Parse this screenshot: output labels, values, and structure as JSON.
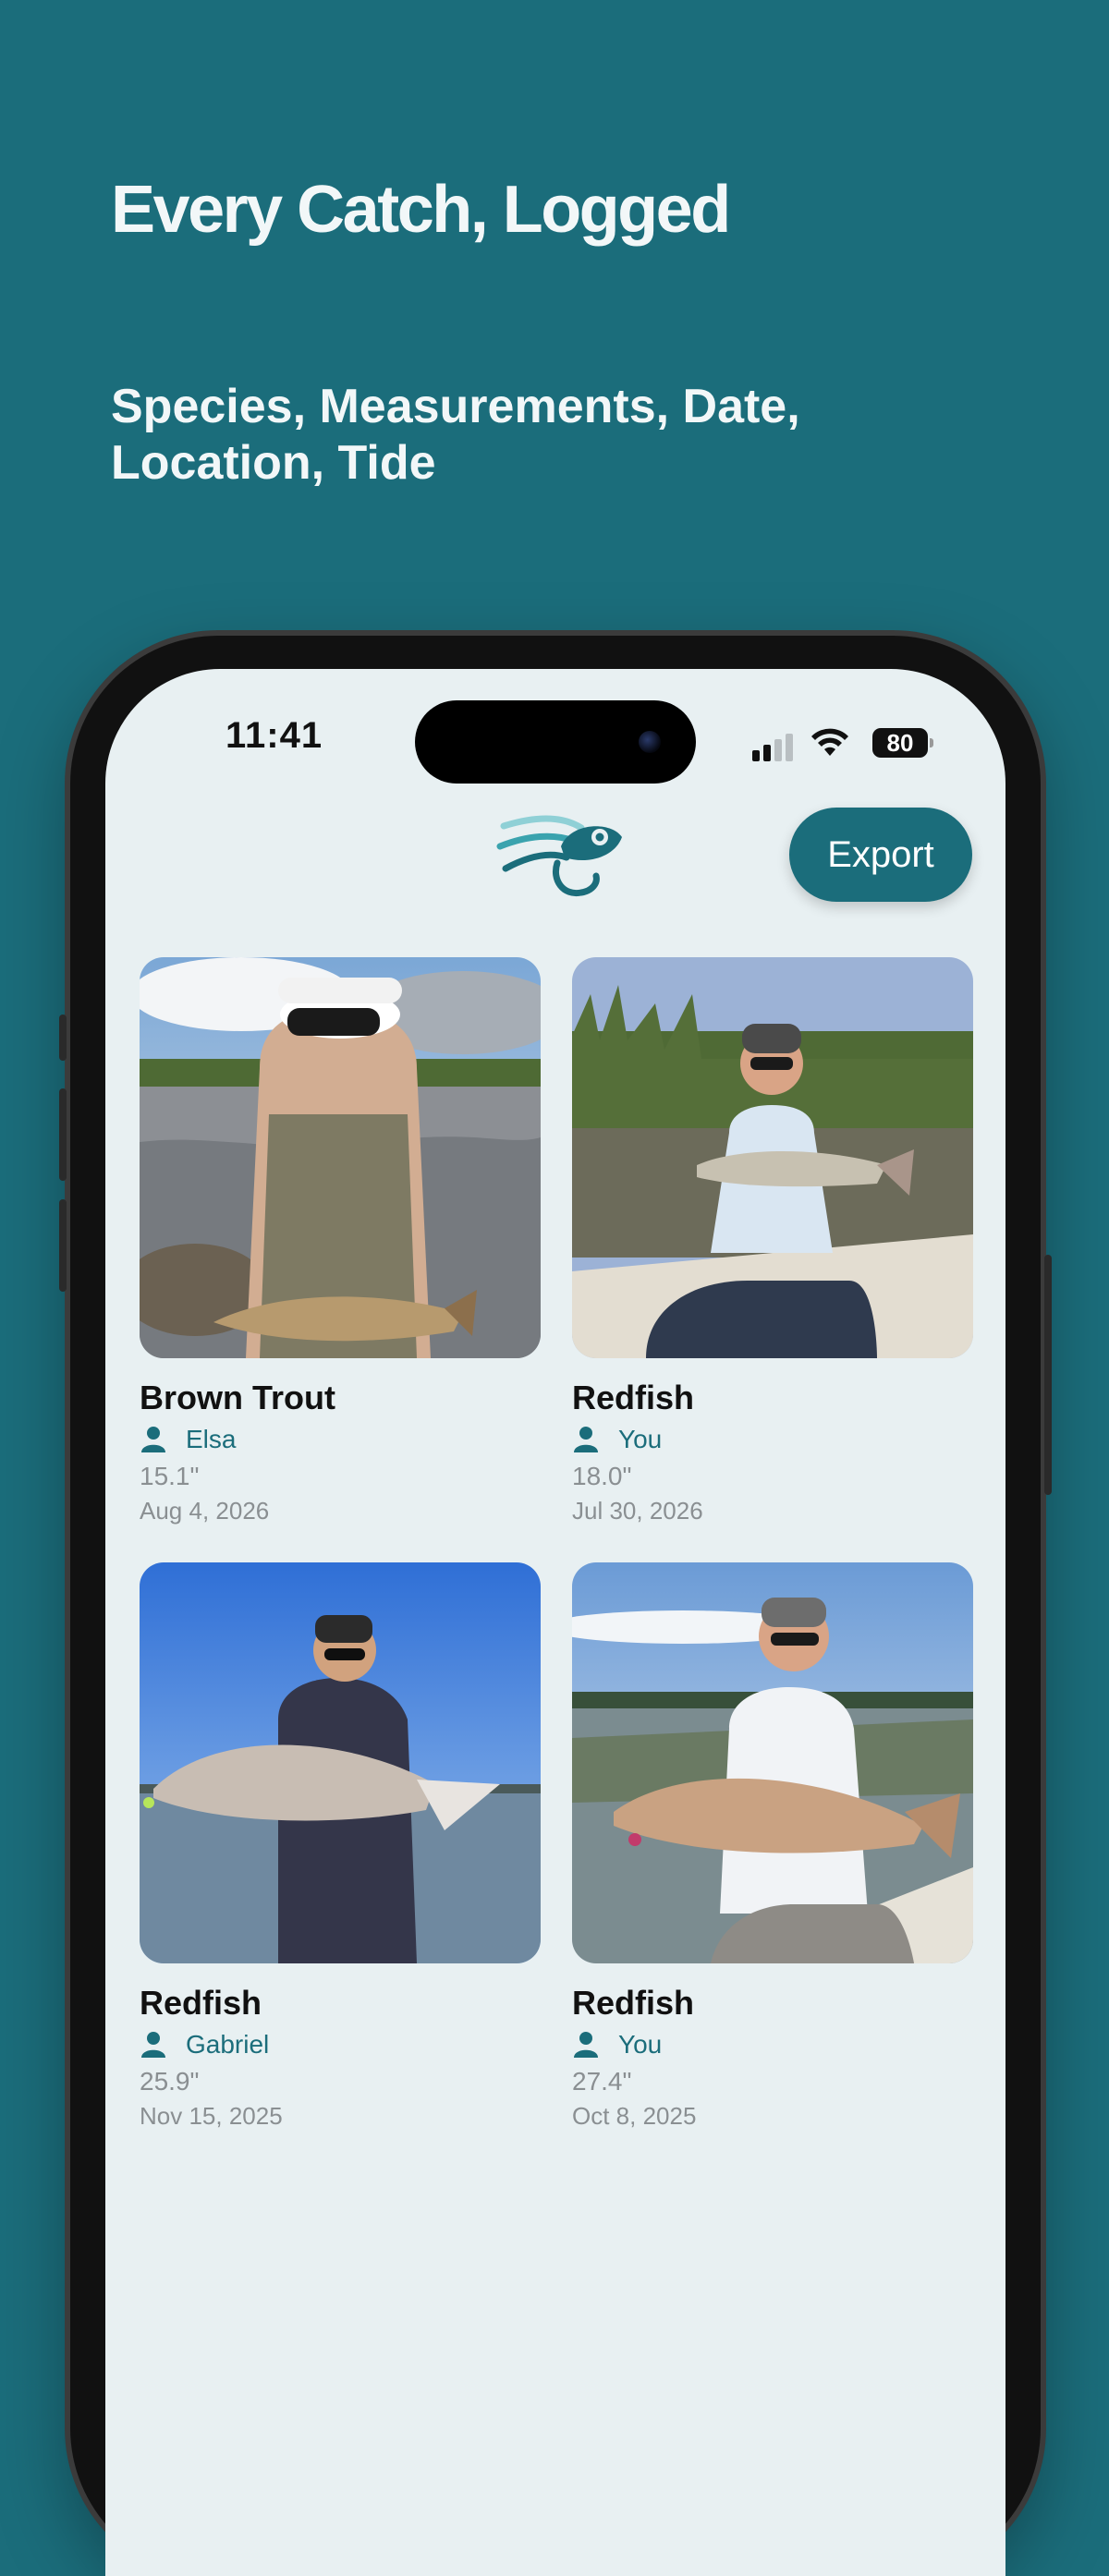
{
  "hero": {
    "headline": "Every Catch, Logged",
    "subhead": "Species, Measurements, Date, Location, Tide"
  },
  "status_bar": {
    "time": "11:41",
    "battery": "80"
  },
  "header": {
    "logo_icon": "fish-logo-icon",
    "export_label": "Export"
  },
  "colors": {
    "brand": "#1b6d7b",
    "background": "#e8f0f2"
  },
  "catches": [
    {
      "species": "Brown Trout",
      "angler": "Elsa",
      "length": "15.1\"",
      "date": "Aug 4, 2026"
    },
    {
      "species": "Redfish",
      "angler": "You",
      "length": "18.0\"",
      "date": "Jul 30, 2026"
    },
    {
      "species": "Redfish",
      "angler": "Gabriel",
      "length": "25.9\"",
      "date": "Nov 15, 2025"
    },
    {
      "species": "Redfish",
      "angler": "You",
      "length": "27.4\"",
      "date": "Oct 8, 2025"
    }
  ]
}
